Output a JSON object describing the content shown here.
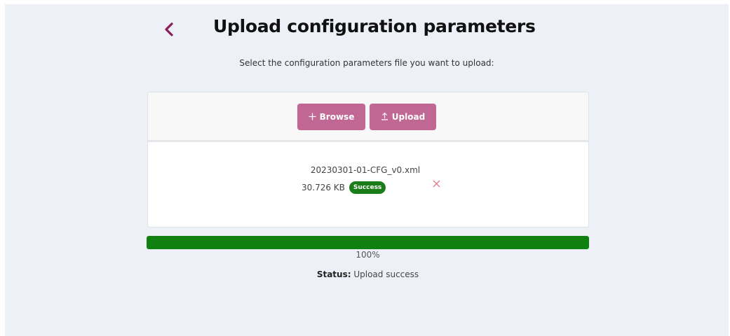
{
  "header": {
    "title": "Upload configuration parameters",
    "back_icon": "chevron-left-icon"
  },
  "instruction": "Select the configuration parameters file you want to upload:",
  "toolbar": {
    "browse_label": "Browse",
    "browse_icon": "plus-icon",
    "upload_label": "Upload",
    "upload_icon": "upload-icon"
  },
  "file": {
    "name": "20230301-01-CFG_v0.xml",
    "size": "30.726 KB",
    "status_badge": "Success",
    "remove_icon": "close-icon"
  },
  "progress": {
    "value": 100,
    "label": "100%"
  },
  "status": {
    "key": "Status:",
    "value": "Upload success"
  },
  "colors": {
    "page_background": "#edf0f7",
    "accent": "#8c1c5a",
    "button": "#c06794",
    "success": "#108010",
    "remove": "#e07b84"
  }
}
